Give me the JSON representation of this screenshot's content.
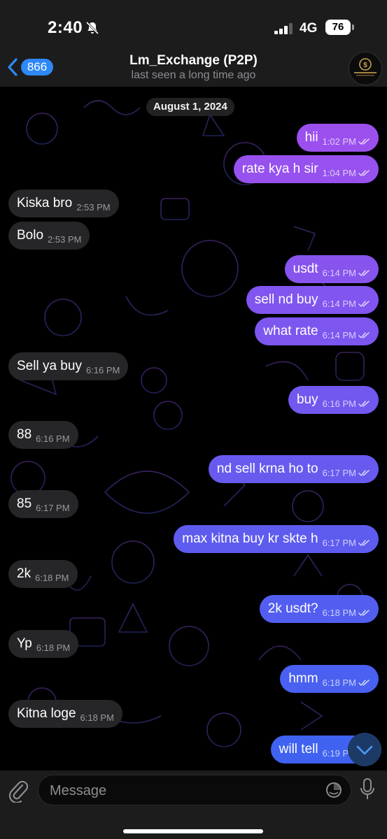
{
  "status_bar": {
    "time": "2:40",
    "network": "4G",
    "battery": "76"
  },
  "header": {
    "back_count": "866",
    "title": "Lm_Exchange (P2P)",
    "subtitle": "last seen a long time ago",
    "icons": {
      "back": "chevron-left-icon",
      "avatar": "channel-avatar"
    }
  },
  "chat": {
    "date": "August 1, 2024",
    "messages": [
      {
        "dir": "out",
        "text": "hii",
        "time": "1:02 PM"
      },
      {
        "dir": "out",
        "text": "rate kya h sir",
        "time": "1:04 PM"
      },
      {
        "dir": "in",
        "text": "Kiska bro",
        "time": "2:53 PM"
      },
      {
        "dir": "in",
        "text": "Bolo",
        "time": "2:53 PM"
      },
      {
        "dir": "out",
        "text": "usdt",
        "time": "6:14 PM"
      },
      {
        "dir": "out",
        "text": "sell nd buy",
        "time": "6:14 PM"
      },
      {
        "dir": "out",
        "text": "what rate",
        "time": "6:14 PM"
      },
      {
        "dir": "in",
        "text": "Sell ya buy",
        "time": "6:16 PM"
      },
      {
        "dir": "out",
        "text": "buy",
        "time": "6:16 PM"
      },
      {
        "dir": "in",
        "text": "88",
        "time": "6:16 PM"
      },
      {
        "dir": "out",
        "text": "nd sell krna ho to",
        "time": "6:17 PM"
      },
      {
        "dir": "in",
        "text": "85",
        "time": "6:17 PM"
      },
      {
        "dir": "out",
        "text": "max kitna buy kr skte h",
        "time": "6:17 PM"
      },
      {
        "dir": "in",
        "text": "2k",
        "time": "6:18 PM"
      },
      {
        "dir": "out",
        "text": "2k usdt?",
        "time": "6:18 PM"
      },
      {
        "dir": "in",
        "text": "Yp",
        "time": "6:18 PM"
      },
      {
        "dir": "out",
        "text": "hmm",
        "time": "6:18 PM"
      },
      {
        "dir": "in",
        "text": "Kitna loge",
        "time": "6:18 PM"
      },
      {
        "dir": "out",
        "text": "will tell",
        "time": "6:19 PM"
      }
    ]
  },
  "input": {
    "placeholder": "Message"
  },
  "colors": {
    "outgoing_top": "#9b50ee",
    "outgoing_bottom": "#3f62f0",
    "incoming": "#262628",
    "accent": "#2e88f6"
  }
}
